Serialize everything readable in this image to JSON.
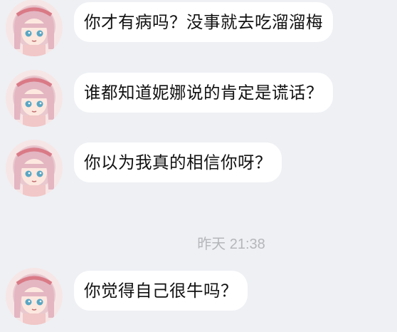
{
  "messages": [
    {
      "text": "你才有病吗？没事就去吃溜溜梅"
    },
    {
      "text": "谁都知道妮娜说的肯定是谎话？"
    },
    {
      "text": "你以为我真的相信你呀？"
    },
    {
      "text": "你觉得自己很牛吗？"
    }
  ],
  "timestamp": "昨天 21:38",
  "colors": {
    "background": "#eef0f4",
    "bubble": "#ffffff",
    "text": "#111111",
    "timestamp": "#b4b6ba"
  },
  "icons": {
    "avatar": "anime-girl-avatar-icon"
  }
}
